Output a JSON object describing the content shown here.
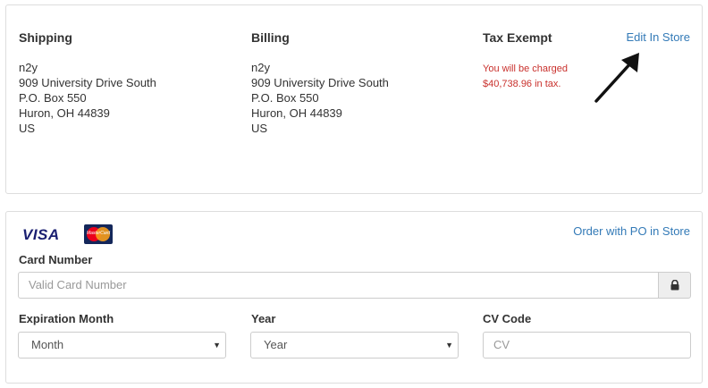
{
  "address": {
    "shipping": {
      "title": "Shipping",
      "lines": [
        "n2y",
        "909 University Drive South",
        "P.O. Box 550",
        "Huron, OH 44839",
        "US"
      ]
    },
    "billing": {
      "title": "Billing",
      "lines": [
        "n2y",
        "909 University Drive South",
        "P.O. Box 550",
        "Huron, OH 44839",
        "US"
      ]
    },
    "tax": {
      "title": "Tax Exempt",
      "note_line1": "You will be charged",
      "note_line2": "$40,738.96 in tax."
    },
    "edit_link": "Edit In Store"
  },
  "payment": {
    "logos": {
      "visa": "VISA",
      "mastercard": "MasterCard"
    },
    "order_po_link": "Order with PO in Store",
    "card_number": {
      "label": "Card Number",
      "placeholder": "Valid Card Number"
    },
    "lock_icon": "lock-icon",
    "expiration_month": {
      "label": "Expiration Month",
      "value": "Month"
    },
    "year": {
      "label": "Year",
      "value": "Year"
    },
    "cv_code": {
      "label": "CV Code",
      "placeholder": "CV"
    }
  },
  "colors": {
    "link": "#337ab7",
    "tax_warning": "#c9302c",
    "border": "#dddddd"
  }
}
